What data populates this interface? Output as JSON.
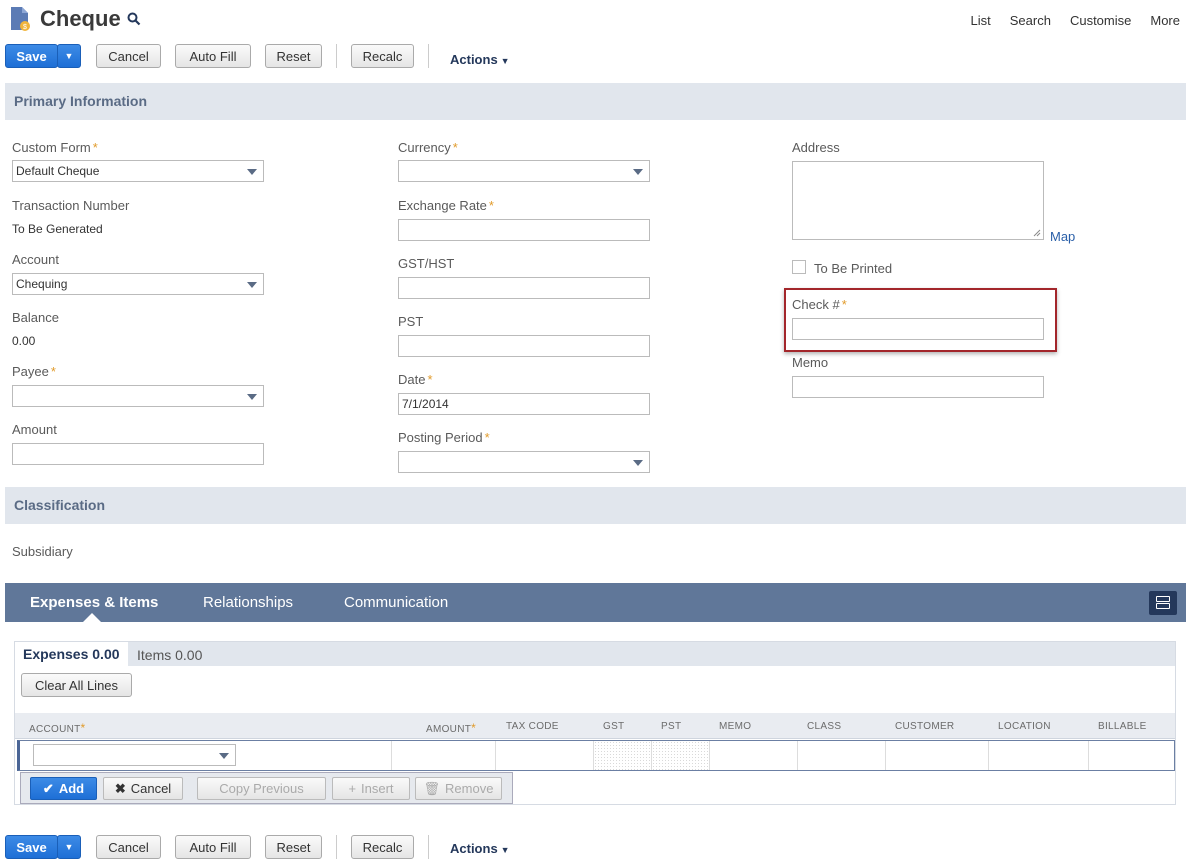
{
  "header": {
    "title": "Cheque",
    "links": [
      "List",
      "Search",
      "Customise",
      "More"
    ]
  },
  "toolbar": {
    "save": "Save",
    "cancel": "Cancel",
    "auto_fill": "Auto Fill",
    "reset": "Reset",
    "recalc": "Recalc",
    "actions": "Actions"
  },
  "sections": {
    "primary": "Primary Information",
    "classification": "Classification"
  },
  "fields": {
    "custom_form": {
      "label": "Custom Form",
      "value": "Default Cheque"
    },
    "transaction_number": {
      "label": "Transaction Number",
      "value": "To Be Generated"
    },
    "account": {
      "label": "Account",
      "value": "Chequing"
    },
    "balance": {
      "label": "Balance",
      "value": "0.00"
    },
    "payee": {
      "label": "Payee",
      "value": ""
    },
    "amount": {
      "label": "Amount",
      "value": ""
    },
    "currency": {
      "label": "Currency",
      "value": ""
    },
    "exchange_rate": {
      "label": "Exchange Rate",
      "value": ""
    },
    "gst_hst": {
      "label": "GST/HST",
      "value": ""
    },
    "pst": {
      "label": "PST",
      "value": ""
    },
    "date": {
      "label": "Date",
      "value": "7/1/2014"
    },
    "posting_period": {
      "label": "Posting Period",
      "value": ""
    },
    "address": {
      "label": "Address",
      "value": ""
    },
    "map_link": "Map",
    "to_be_printed": {
      "label": "To Be Printed",
      "checked": false
    },
    "check_number": {
      "label": "Check #",
      "value": ""
    },
    "memo": {
      "label": "Memo",
      "value": ""
    },
    "subsidiary": {
      "label": "Subsidiary"
    }
  },
  "tabs": [
    {
      "label": "Expenses & Items",
      "active": true
    },
    {
      "label": "Relationships",
      "active": false
    },
    {
      "label": "Communication",
      "active": false
    }
  ],
  "subtabs": {
    "expenses": "Expenses 0.00",
    "items": "Items 0.00"
  },
  "clear_all_lines": "Clear All Lines",
  "columns": [
    "Account",
    "Amount",
    "Tax Code",
    "GST",
    "PST",
    "Memo",
    "Class",
    "Customer",
    "Location",
    "Billable"
  ],
  "row_buttons": {
    "add": "Add",
    "cancel": "Cancel",
    "copy_previous": "Copy Previous",
    "insert": "Insert",
    "remove": "Remove"
  },
  "colors": {
    "primary_blue": "#1e6fd6",
    "tab_bar": "#607799",
    "section_bg": "#e1e6ed",
    "required": "#e19b2b",
    "highlight": "#a3262b"
  }
}
